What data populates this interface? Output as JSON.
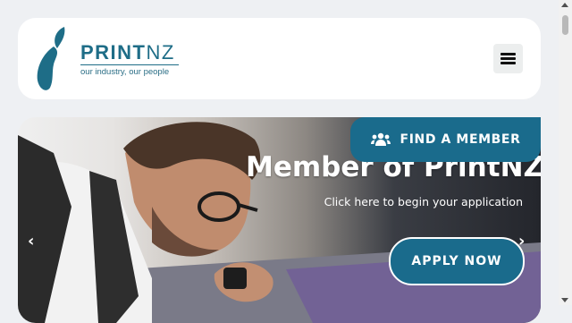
{
  "header": {
    "logo": {
      "brand_prefix": "PRINT",
      "brand_suffix": "NZ",
      "tagline": "our industry, our people"
    },
    "menu_icon": "hamburger-menu-icon"
  },
  "find_member": {
    "label": "FIND A MEMBER",
    "icon": "users-icon"
  },
  "hero": {
    "title": "Member of PrintNZ",
    "subtitle": "Click here to begin your application",
    "apply_label": "APPLY NOW",
    "prev_arrow": "‹",
    "next_arrow": "›"
  },
  "colors": {
    "brand": "#1a6b8c",
    "page_bg": "#eef0f3"
  }
}
